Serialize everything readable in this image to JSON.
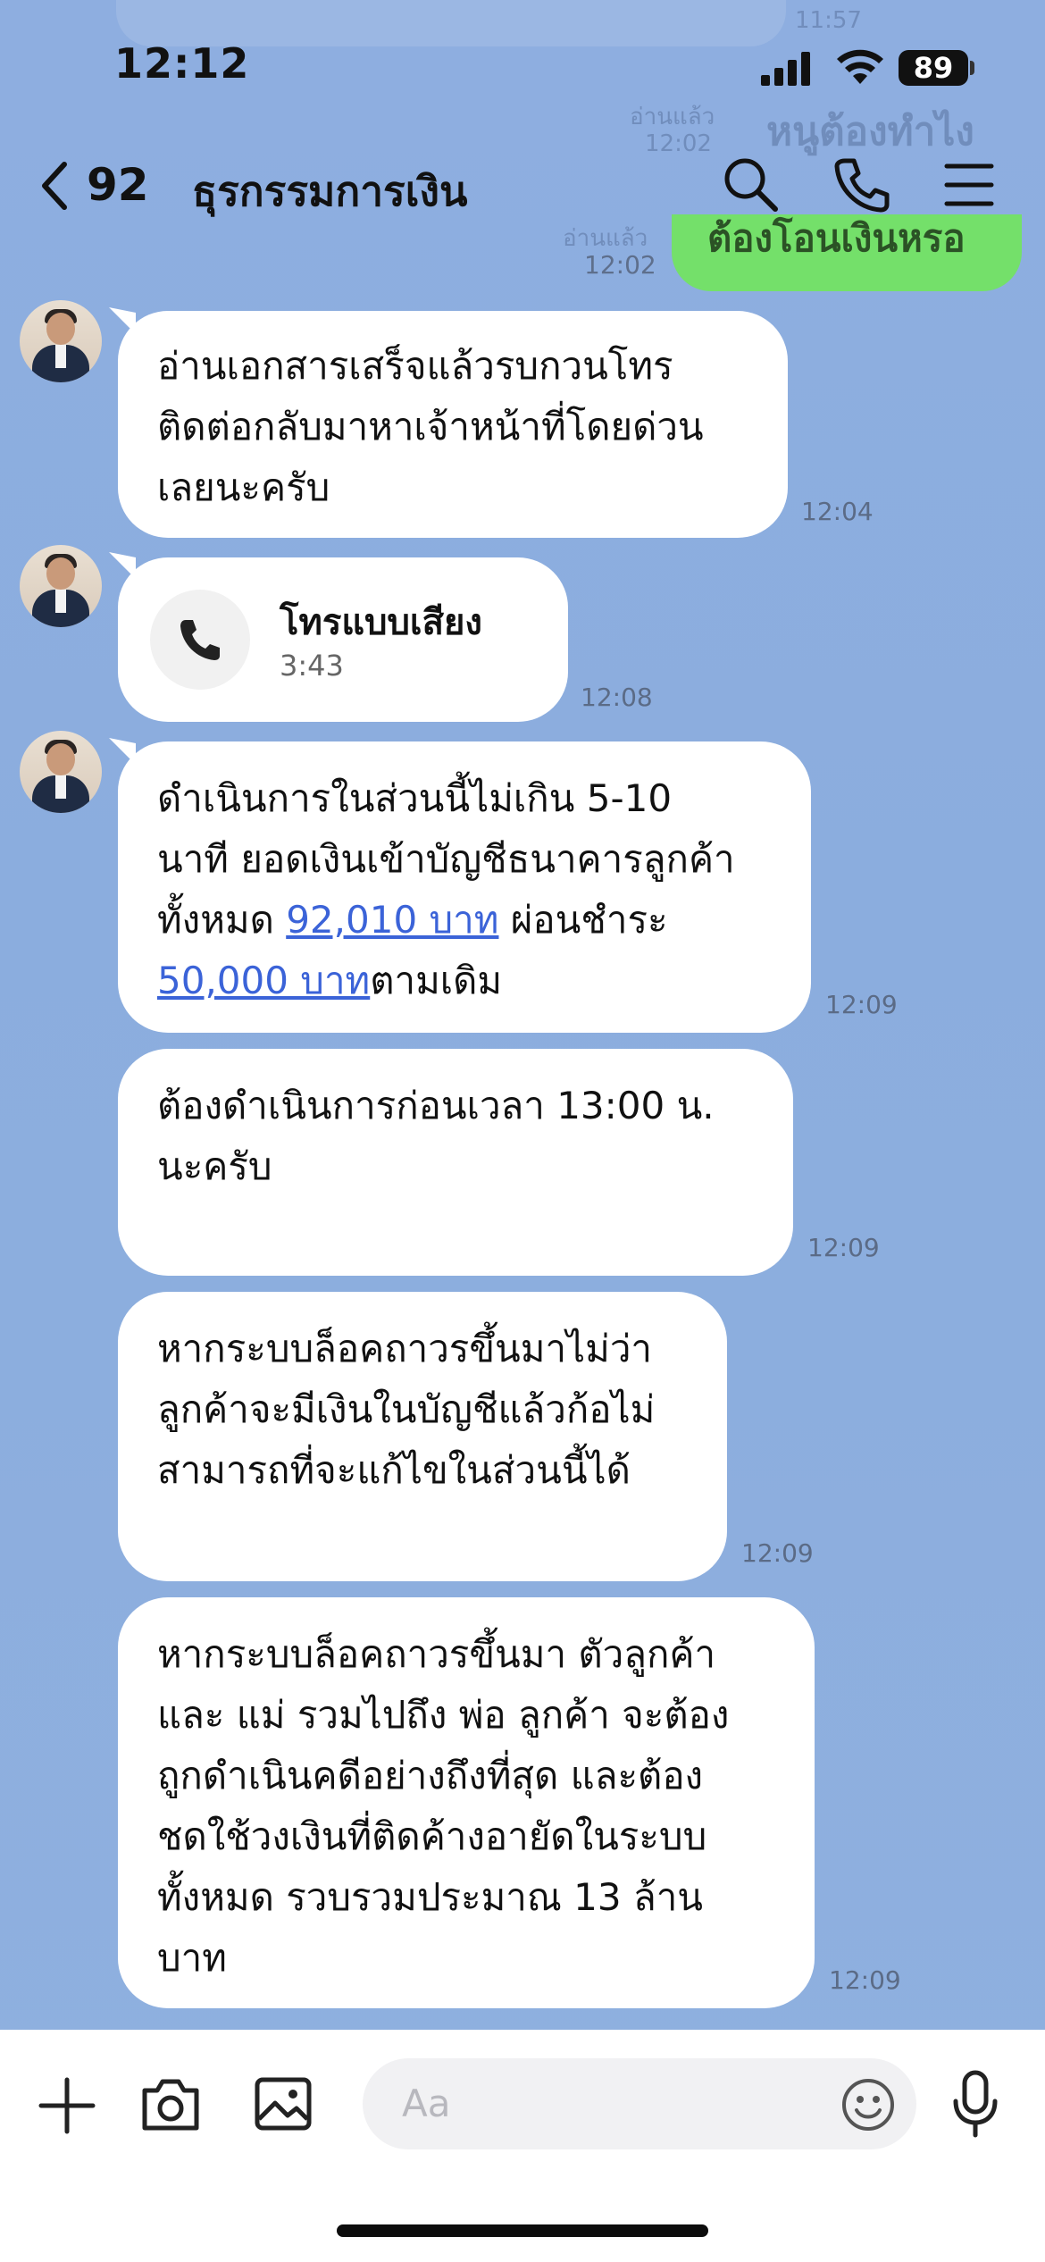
{
  "status_bar": {
    "time": "12:12",
    "battery": "89"
  },
  "background_fragments": {
    "time_1": "11:57",
    "read_1": "อ่านแล้ว",
    "time_2": "12:02",
    "partial_text": "หนูต้องทำไง",
    "read_2": "อ่านแล้ว"
  },
  "header": {
    "back_count": "92",
    "title": "ธุรกรรมการเงิน"
  },
  "top_partial": {
    "text": "ต้องโอนเงินหรอ",
    "time": "12:02"
  },
  "messages": [
    {
      "text": "อ่านเอกสารเสร็จแล้วรบกวนโทร\nติดต่อกลับมาหาเจ้าหน้าที่โดยด่วน\nเลยนะครับ",
      "time": "12:04"
    },
    {
      "call_title": "โทรแบบเสียง",
      "call_duration": "3:43",
      "time": "12:08"
    },
    {
      "line1": "ดำเนินการในส่วนนี้ไม่เกิน 5-10",
      "line2": "นาที ยอดเงินเข้าบัญชีธนาคารลูกค้า",
      "line3_pre": "ทั้งหมด ",
      "link1": "92,010 บาท",
      "line3_post": " ผ่อนชำระ",
      "link2": "50,000 บาท",
      "line4_post": "ตามเดิม",
      "time": "12:09"
    },
    {
      "text": "ต้องดำเนินการก่อนเวลา 13:00 น.\nนะครับ",
      "time": "12:09"
    },
    {
      "text": "หากระบบล็อคถาวรขึ้นมาไม่ว่า\nลูกค้าจะมีเงินในบัญชีแล้วก้อไม่\nสามารถที่จะแก้ไขในส่วนนี้ได้",
      "time": "12:09"
    },
    {
      "text": "หากระบบล็อคถาวรขึ้นมา ตัวลูกค้า\nและ แม่ รวมไปถึง พ่อ ลูกค้า  จะต้อง\nถูกดำเนินคดีอย่างถึงที่สุด และต้อง\nชดใช้วงเงินที่ติดค้างอายัดในระบบ\nทั้งหมด รวบรวมประมาณ 13 ล้าน\nบาท",
      "time": "12:09"
    }
  ],
  "input": {
    "placeholder": "Aa"
  },
  "colors": {
    "background": "#8eaee0",
    "green_bubble": "#74e06a",
    "link": "#3b63d8"
  }
}
